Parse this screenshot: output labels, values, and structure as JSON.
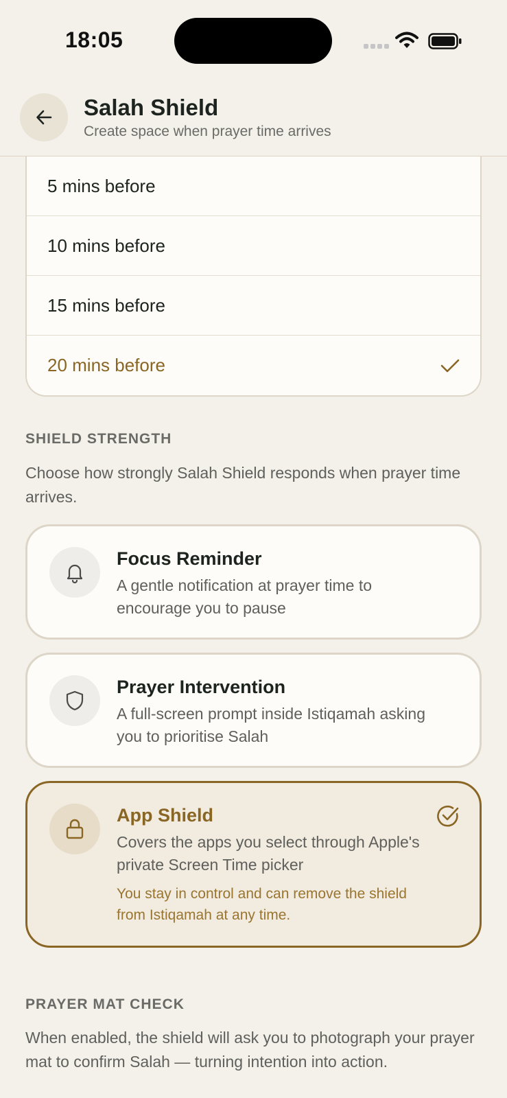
{
  "status_bar": {
    "time": "18:05"
  },
  "header": {
    "title": "Salah Shield",
    "subtitle": "Create space when prayer time arrives"
  },
  "reminder_options": [
    {
      "label": "5 mins before",
      "selected": false
    },
    {
      "label": "10 mins before",
      "selected": false
    },
    {
      "label": "15 mins before",
      "selected": false
    },
    {
      "label": "20 mins before",
      "selected": true
    }
  ],
  "shield_strength": {
    "label": "SHIELD STRENGTH",
    "description": "Choose how strongly Salah Shield responds when prayer time arrives.",
    "options": [
      {
        "title": "Focus Reminder",
        "description": "A gentle notification at prayer time to encourage you to pause",
        "icon": "bell-icon",
        "selected": false
      },
      {
        "title": "Prayer Intervention",
        "description": "A full-screen prompt inside Istiqamah asking you to prioritise Salah",
        "icon": "shield-icon",
        "selected": false
      },
      {
        "title": "App Shield",
        "description": "Covers the apps you select through Apple's private Screen Time picker",
        "note": "You stay in control and can remove the shield from Istiqamah at any time.",
        "icon": "lock-icon",
        "selected": true
      }
    ]
  },
  "prayer_mat_check": {
    "label": "PRAYER MAT CHECK",
    "description": "When enabled, the shield will ask you to photograph your prayer mat to confirm Salah — turning intention into action."
  },
  "colors": {
    "background": "#f4f1eb",
    "card": "#fdfcf8",
    "accent": "#8a6625",
    "active_card": "#f1ebe0",
    "border": "#ddd6c8",
    "text": "#1d231f",
    "muted_text": "#5f5f5b"
  }
}
